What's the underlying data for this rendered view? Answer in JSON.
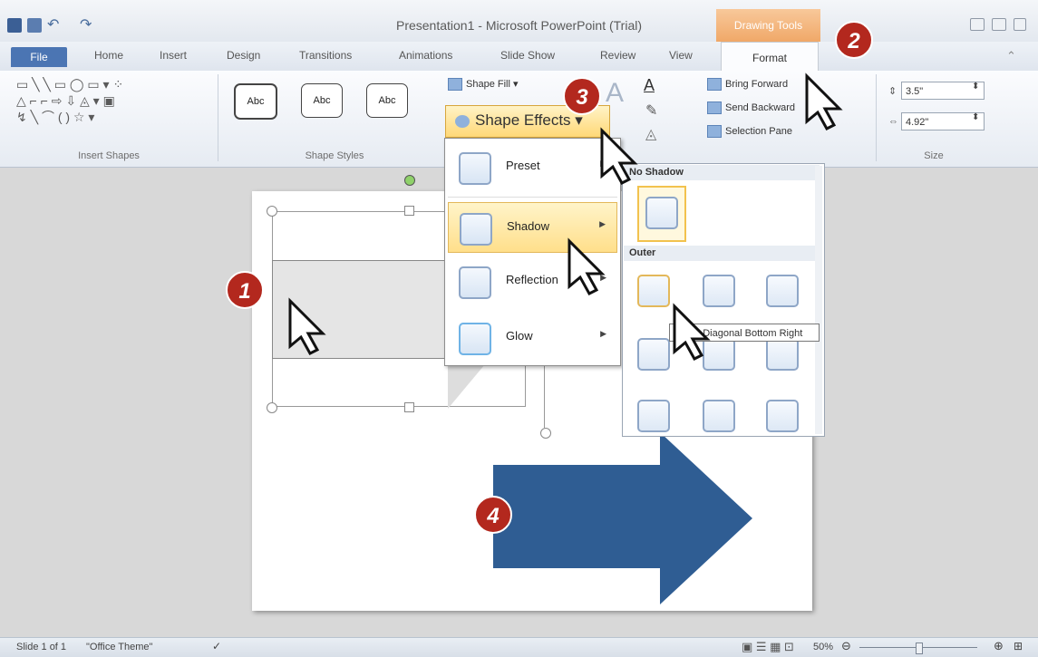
{
  "window": {
    "title": "Presentation1 - Microsoft PowerPoint (Trial)",
    "context_tab": "Drawing Tools"
  },
  "tabs": [
    "File",
    "Home",
    "Insert",
    "Design",
    "Transitions",
    "Animations",
    "Slide Show",
    "Review",
    "View",
    "Format"
  ],
  "ribbon": {
    "insert_shapes_label": "Insert Shapes",
    "style_thumbs": [
      "Abc",
      "Abc",
      "Abc"
    ],
    "shape_styles_label": "Shape Styles",
    "shape_fill": "Shape Fill",
    "shape_effects": "Shape Effects",
    "arrange_items": [
      "Bring Forward",
      "Send Backward",
      "Selection Pane"
    ],
    "height": "3.5\"",
    "width": "4.92\"",
    "size_label": "Size"
  },
  "effects_menu": [
    {
      "label": "Preset"
    },
    {
      "label": "Shadow"
    },
    {
      "label": "Reflection"
    },
    {
      "label": "Glow"
    }
  ],
  "shadow_gallery": {
    "no_shadow": "No Shadow",
    "outer": "Outer",
    "tooltip": "Offset Diagonal Bottom Right"
  },
  "badges": [
    "1",
    "2",
    "3",
    "4"
  ],
  "status": {
    "slide": "Slide 1 of 1",
    "theme": "\"Office Theme\"",
    "zoom": "50%"
  },
  "colors": {
    "accent": "#2f5d93",
    "badge": "#b3281e",
    "file_tab": "#4b75b3",
    "highlight": "#ffd877"
  }
}
